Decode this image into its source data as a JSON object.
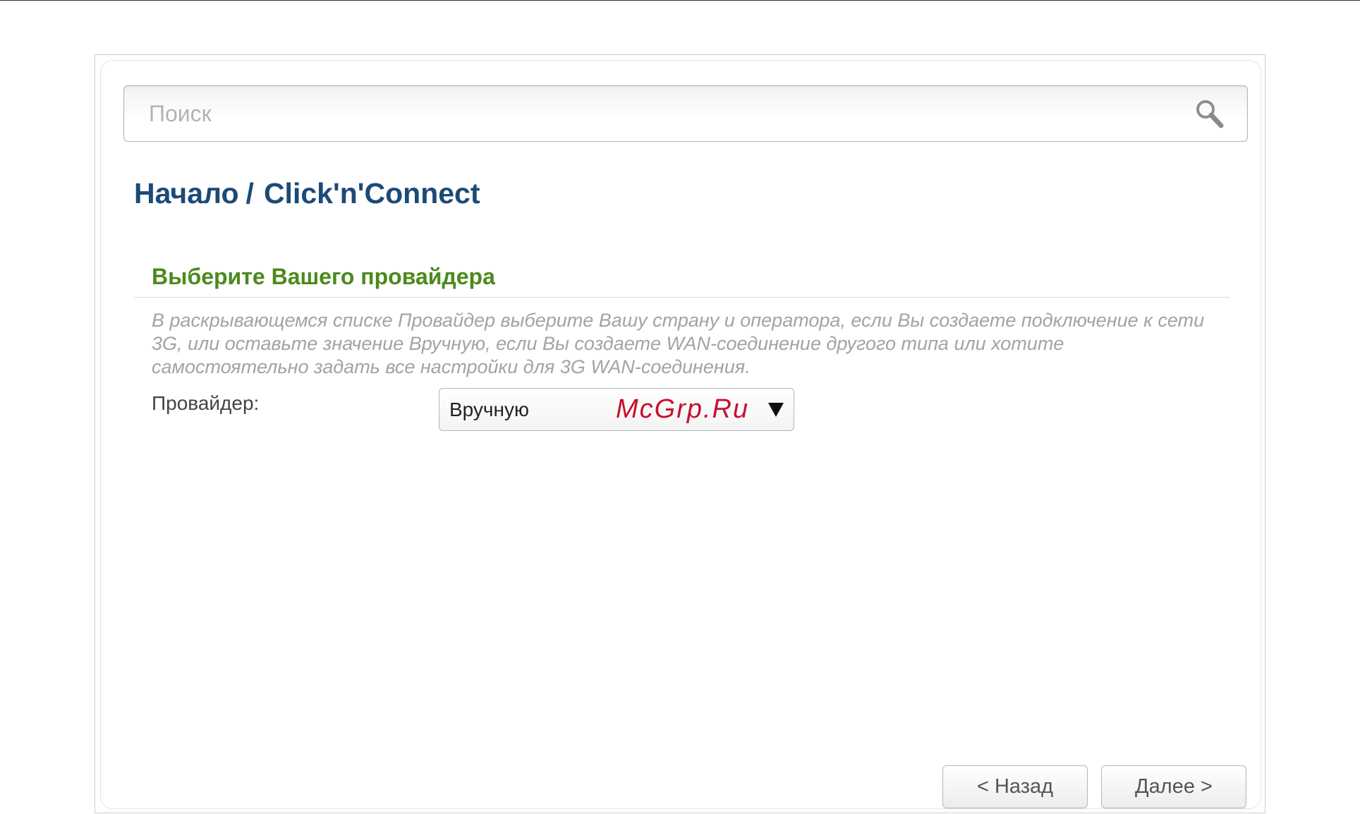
{
  "search": {
    "placeholder": "Поиск"
  },
  "breadcrumb": {
    "root": "Начало",
    "separator": "/",
    "current": "Click'n'Connect"
  },
  "section": {
    "title": "Выберите Вашего провайдера",
    "description": "В раскрывающемся списке Провайдер выберите Вашу страну и оператора, если Вы создаете подключение к сети 3G, или оставьте значение Вручную, если Вы создаете WAN-соединение другого типа или хотите самостоятельно задать все настройки для 3G WAN-соединения."
  },
  "provider": {
    "label": "Провайдер:",
    "selected": "Вручную",
    "watermark": "McGrp.Ru"
  },
  "nav": {
    "back_label": "< Назад",
    "next_label": "Далее >"
  },
  "colors": {
    "title_blue": "#1c4a78",
    "section_green": "#4c8a1c",
    "watermark_red": "#c8102e"
  }
}
